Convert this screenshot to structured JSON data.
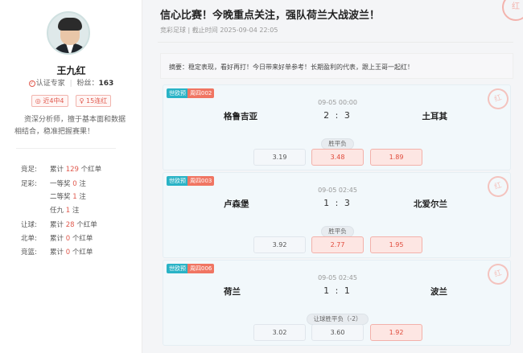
{
  "profile": {
    "name": "王九红",
    "cert_label": "认证专家",
    "fans_label": "粉丝：",
    "fans_count": "163",
    "tags": [
      "近4中4",
      "15连红"
    ],
    "intro": "资深分析师，擅于基本面和数据相结合，稳准把握赛果！",
    "stats": [
      {
        "label": "竞足:",
        "prefix": "累计",
        "value": "129",
        "suffix": "个红单"
      },
      {
        "label": "足彩:",
        "prefix": "一等奖",
        "value": "0",
        "suffix": "注"
      },
      {
        "label": "",
        "prefix": "二等奖",
        "value": "1",
        "suffix": "注"
      },
      {
        "label": "",
        "prefix": "任九",
        "value": "1",
        "suffix": "注"
      },
      {
        "label": "让球:",
        "prefix": "累计",
        "value": "28",
        "suffix": "个红单"
      },
      {
        "label": "北单:",
        "prefix": "累计",
        "value": "0",
        "suffix": "个红单"
      },
      {
        "label": "竞篮:",
        "prefix": "累计",
        "value": "0",
        "suffix": "个红单"
      }
    ]
  },
  "article": {
    "title": "信心比赛！今晚重点关注，强队荷兰大战波兰！",
    "meta": "竞彩足球 | 截止时间 2025-09-04 22:05",
    "summary": "摘要：稳定表现，看好再打！今日带来好单参考！长期盈利的代表，跟上王哥一起红！",
    "stamp": "红"
  },
  "matches": [
    {
      "league": "世欧预",
      "code": "周四002",
      "time": "09-05 00:00",
      "home": "格鲁吉亚",
      "score": "2 : 3",
      "away": "土耳其",
      "play_type": "胜平负",
      "odds": [
        "3.19",
        "3.48",
        "1.89"
      ],
      "picks": [
        false,
        true,
        true
      ],
      "stamp": "红"
    },
    {
      "league": "世欧预",
      "code": "周四003",
      "time": "09-05 02:45",
      "home": "卢森堡",
      "score": "1 : 3",
      "away": "北爱尔兰",
      "play_type": "胜平负",
      "odds": [
        "3.92",
        "2.77",
        "1.95"
      ],
      "picks": [
        false,
        true,
        true
      ],
      "stamp": "红"
    },
    {
      "league": "世欧预",
      "code": "周四006",
      "time": "09-05 02:45",
      "home": "荷兰",
      "score": "1 : 1",
      "away": "波兰",
      "play_type": "让球胜平负（-2）",
      "odds": [
        "3.02",
        "3.60",
        "1.92"
      ],
      "picks": [
        false,
        false,
        true
      ],
      "stamp": "红"
    }
  ],
  "colors": {
    "accent": "#e05a4e",
    "league_badge": "#29b3c6",
    "code_badge": "#f07562"
  }
}
